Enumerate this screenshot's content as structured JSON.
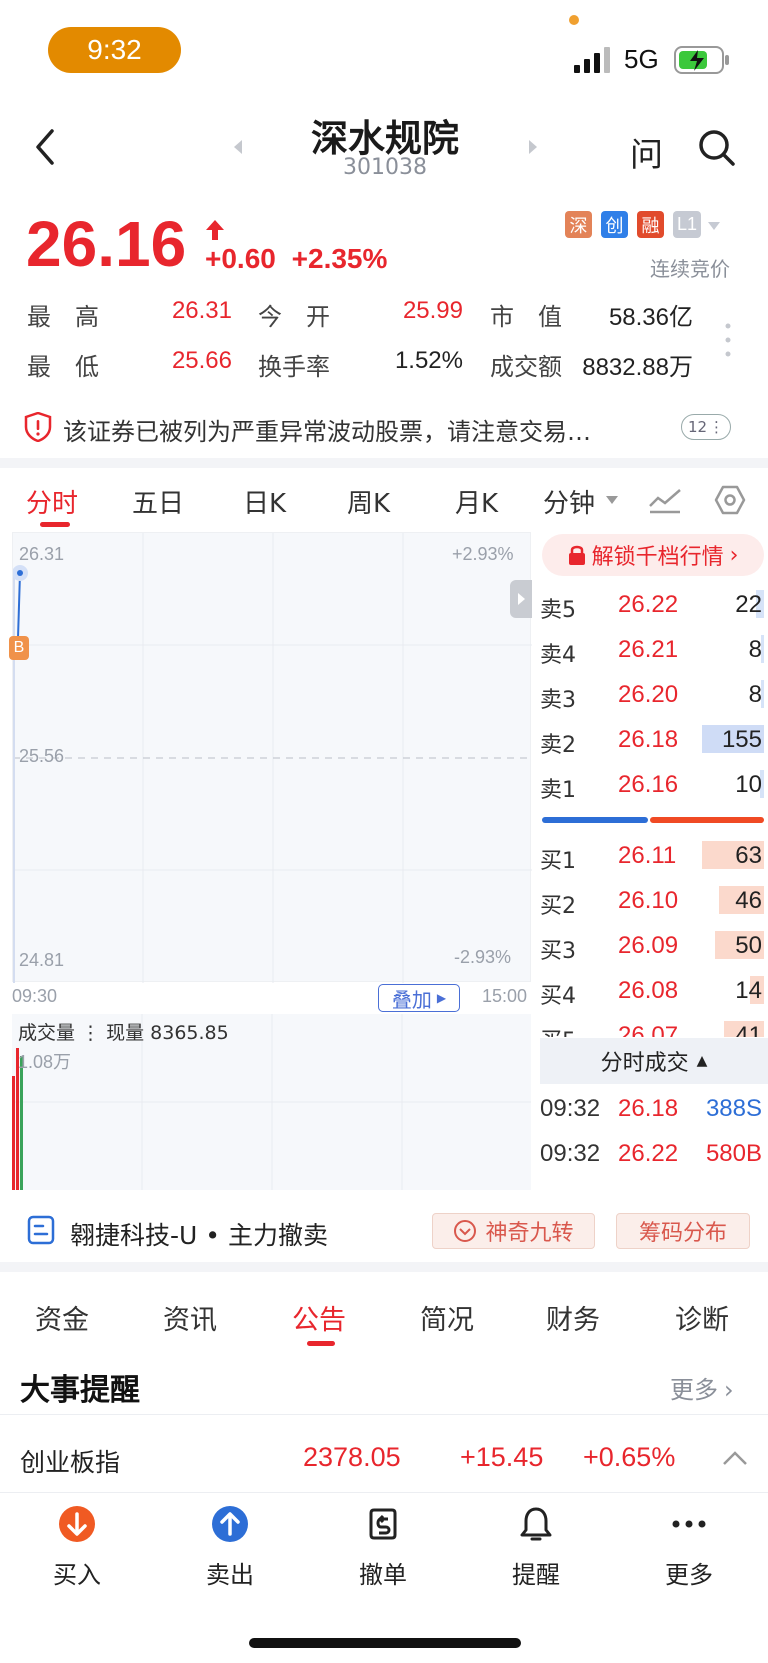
{
  "status_bar": {
    "time": "9:32",
    "network": "5G"
  },
  "header": {
    "name": "深水规院",
    "code": "301038",
    "ask_label": "问"
  },
  "quote": {
    "price": "26.16",
    "change": "+0.60",
    "change_pct": "+2.35%",
    "tags": [
      "深",
      "创",
      "融",
      "L1"
    ],
    "trade_status": "连续竞价",
    "stats": [
      {
        "label": "最　高",
        "value": "26.31",
        "color": "red"
      },
      {
        "label": "今　开",
        "value": "25.99",
        "color": "red"
      },
      {
        "label": "市　值",
        "value": "58.36亿",
        "color": "black"
      },
      {
        "label": "最　低",
        "value": "25.66",
        "color": "red"
      },
      {
        "label": "换手率",
        "value": "1.52%",
        "color": "black"
      },
      {
        "label": "成交额",
        "value": "8832.88万",
        "color": "black"
      }
    ]
  },
  "warning": {
    "text": "该证券已被列为严重异常波动股票，请注意交易…",
    "badge": "12"
  },
  "chart_tabs": [
    "分时",
    "五日",
    "日K",
    "周K",
    "月K",
    "分钟"
  ],
  "chart": {
    "y_max": "26.31",
    "y_mid": "25.56",
    "y_min": "24.81",
    "pct_max": "+2.93%",
    "pct_min": "-2.93%",
    "time_start": "09:30",
    "time_end": "15:00",
    "overlay_label": "叠加",
    "marker": "B",
    "volume_label": "成交量",
    "volume_current": "现量 8365.85",
    "volume_max": "1.08万"
  },
  "order_book": {
    "unlock_label": "解锁千档行情",
    "asks": [
      {
        "label": "卖5",
        "price": "26.22",
        "qty": "22",
        "level": 0.14
      },
      {
        "label": "卖4",
        "price": "26.21",
        "qty": "8",
        "level": 0.05
      },
      {
        "label": "卖3",
        "price": "26.20",
        "qty": "8",
        "level": 0.05
      },
      {
        "label": "卖2",
        "price": "26.18",
        "qty": "155",
        "level": 1.0
      },
      {
        "label": "卖1",
        "price": "26.16",
        "qty": "10",
        "level": 0.06
      }
    ],
    "bids": [
      {
        "label": "买1",
        "price": "26.11",
        "qty": "63",
        "level": 1.0
      },
      {
        "label": "买2",
        "price": "26.10",
        "qty": "46",
        "level": 0.73
      },
      {
        "label": "买3",
        "price": "26.09",
        "qty": "50",
        "level": 0.79
      },
      {
        "label": "买4",
        "price": "26.08",
        "qty": "14",
        "level": 0.22
      },
      {
        "label": "买5",
        "price": "26.07",
        "qty": "41",
        "level": 0.65
      }
    ],
    "ticks_header": "分时成交",
    "ticks": [
      {
        "time": "09:32",
        "price": "26.18",
        "vol": "388S",
        "side": "sell"
      },
      {
        "time": "09:32",
        "price": "26.22",
        "vol": "580B",
        "side": "buy"
      }
    ]
  },
  "news": {
    "text": "翱捷科技-U • 主力撤卖",
    "magic_label": "神奇九转",
    "chip_label": "筹码分布"
  },
  "bottom_tabs": [
    "资金",
    "资讯",
    "公告",
    "简况",
    "财务",
    "诊断"
  ],
  "events": {
    "title": "大事提醒",
    "more": "更多"
  },
  "index": {
    "name": "创业板指",
    "value": "2378.05",
    "change": "+15.45",
    "change_pct": "+0.65%"
  },
  "nav": [
    {
      "label": "买入",
      "icon": "buy-icon"
    },
    {
      "label": "卖出",
      "icon": "sell-icon"
    },
    {
      "label": "撤单",
      "icon": "cancel-order-icon"
    },
    {
      "label": "提醒",
      "icon": "bell-icon"
    },
    {
      "label": "更多",
      "icon": "more-icon"
    }
  ],
  "colors": {
    "up": "#e8262d",
    "down": "#2d6ed6",
    "accent": "#e38a00"
  }
}
